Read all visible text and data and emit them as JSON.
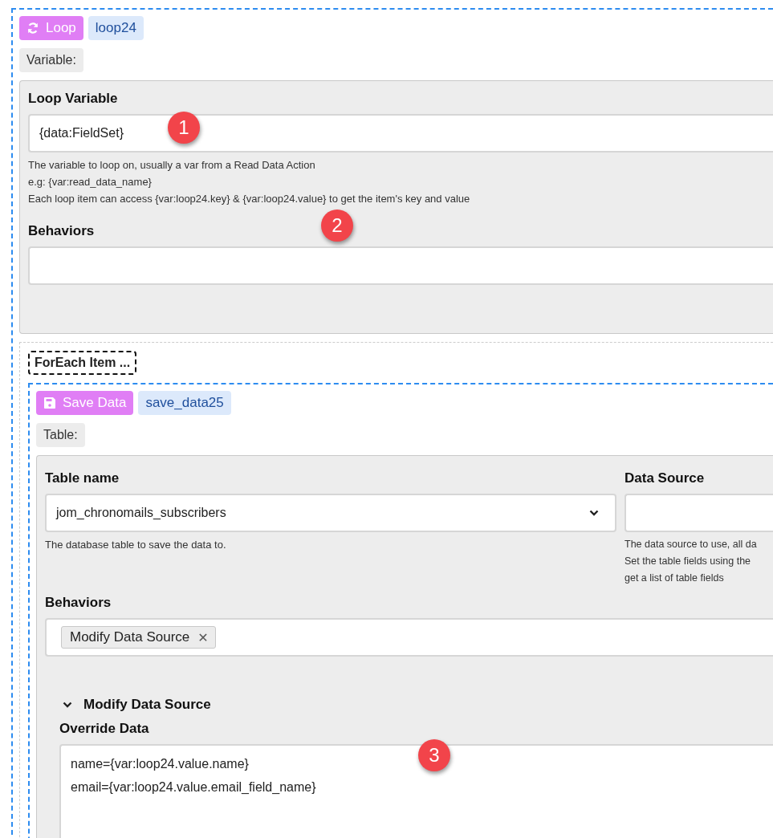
{
  "loop_block": {
    "action": {
      "kind": "loop",
      "label": "Loop"
    },
    "id": "loop24",
    "section_label": "Variable:",
    "panel": {
      "fields": [
        {
          "kind": "text",
          "label": "Loop Variable",
          "value": "{data:FieldSet}",
          "help": [
            "The variable to loop on, usually a var from a Read Data Action",
            "e.g: {var:read_data_name}",
            "Each loop item can access {var:loop24.key} & {var:loop24.value} to get the item's key and value"
          ]
        },
        {
          "kind": "tags",
          "label": "Behaviors"
        }
      ]
    }
  },
  "foreach_label": "ForEach Item ...",
  "save_block": {
    "action": {
      "kind": "save",
      "label": "Save Data"
    },
    "id": "save_data25",
    "section_label": "Table:",
    "columns": [
      {
        "kind": "select",
        "label": "Table name",
        "value": "jom_chronomails_subscribers",
        "help": [
          "The database table to save the data to."
        ]
      },
      {
        "kind": "text",
        "label": "Data Source",
        "help": [
          "The data source to use, all da",
          "Set the table fields using the",
          "get a list of table fields"
        ]
      }
    ],
    "behaviors": {
      "label": "Behaviors",
      "tags": [
        {
          "label": "Modify Data Source",
          "remove": "✕"
        }
      ]
    },
    "section": {
      "title": "Modify Data Source",
      "expanded": true,
      "field": {
        "label": "Override Data",
        "lines": [
          "name={var:loop24.value.name}",
          "email={var:loop24.value.email_field_name}"
        ]
      }
    }
  },
  "callouts": [
    {
      "number": "1"
    },
    {
      "number": "2"
    },
    {
      "number": "3"
    }
  ]
}
